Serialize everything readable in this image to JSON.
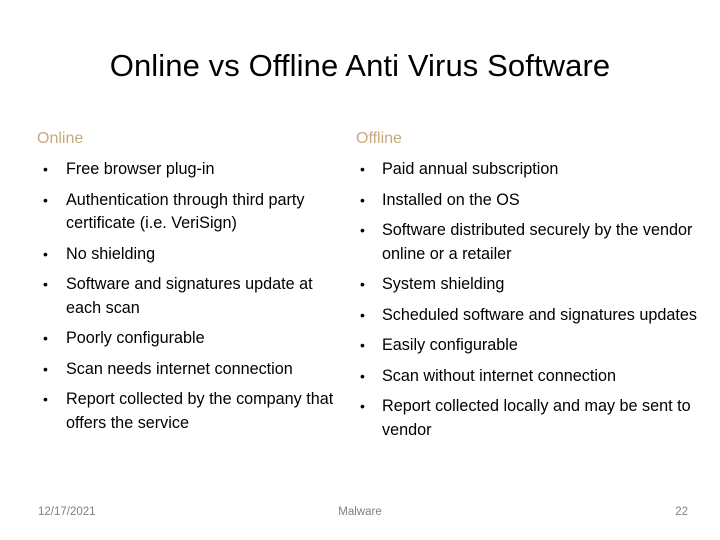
{
  "slide": {
    "title": "Online vs Offline Anti Virus Software",
    "accent_color": "#c8a87e",
    "background_color": "#ffffff",
    "text_color": "#000000",
    "footer_color": "#808080"
  },
  "columns": [
    {
      "heading": "Online",
      "bullet_glyph": "•",
      "items": [
        "Free browser plug-in",
        "Authentication through third party certificate (i.e. VeriSign)",
        "No shielding",
        "Software and signatures update at each scan",
        "Poorly configurable",
        "Scan needs internet connection",
        "Report collected by the company that offers the service"
      ]
    },
    {
      "heading": "Offline",
      "bullet_glyph": "•",
      "items": [
        "Paid annual subscription",
        "Installed on the OS",
        "Software distributed securely by the vendor online or a retailer",
        "System shielding",
        "Scheduled software and signatures updates",
        "Easily configurable",
        "Scan without internet connection",
        "Report collected locally and may be sent to vendor"
      ]
    }
  ],
  "footer": {
    "date": "12/17/2021",
    "center_text": "Malware",
    "page_number": "22"
  }
}
